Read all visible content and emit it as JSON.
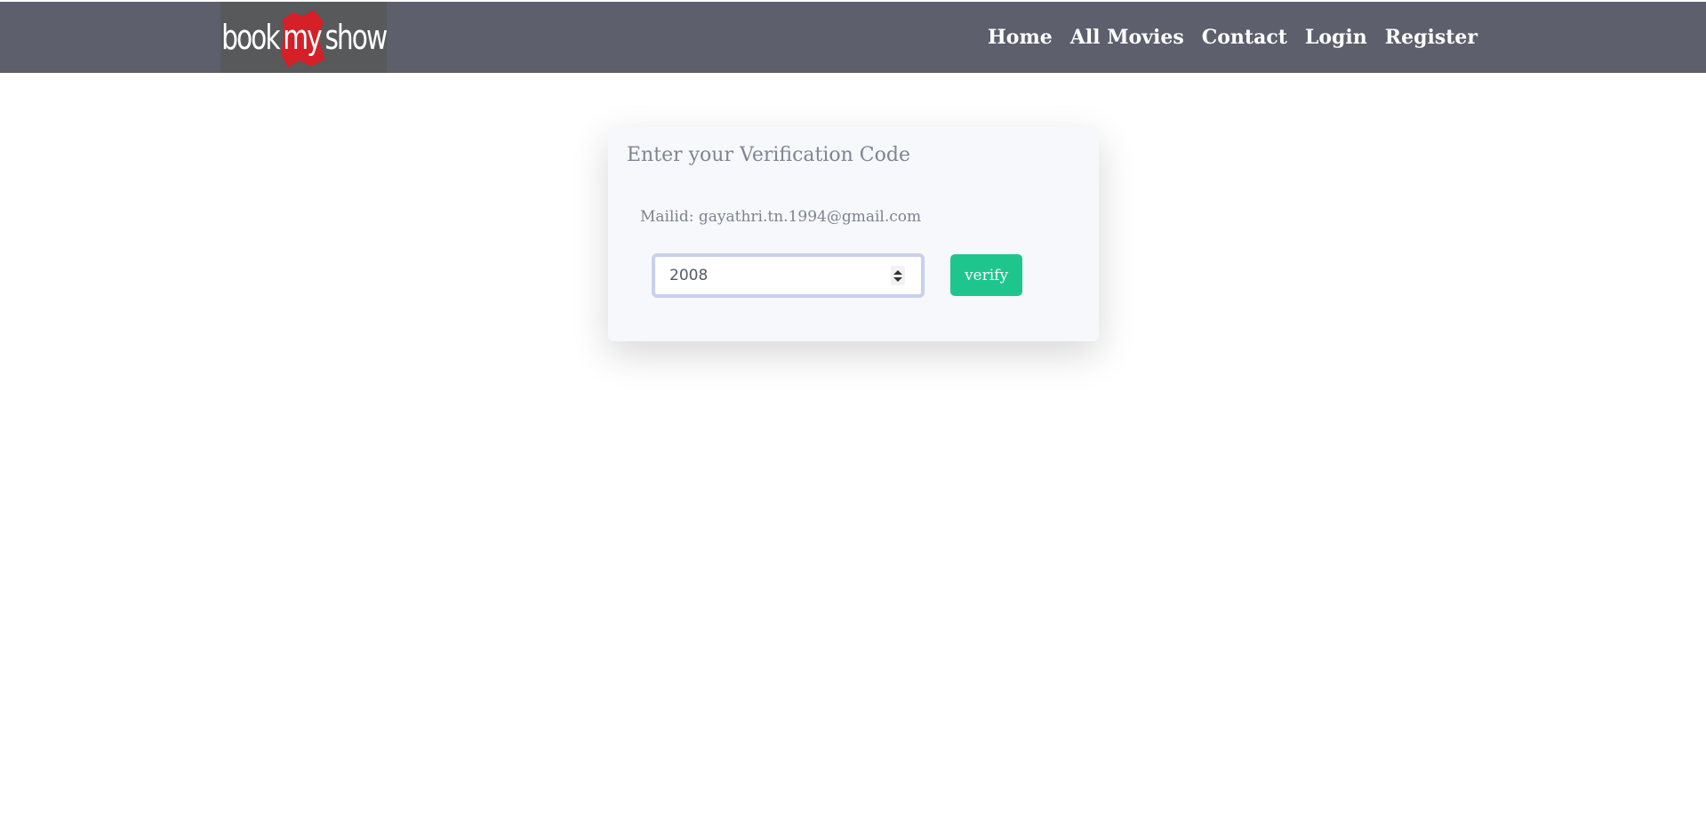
{
  "brand": {
    "logo_left": "book",
    "logo_mid": "my",
    "logo_right": "show",
    "accent": "#d52027"
  },
  "nav": {
    "background": "#5d5f6c",
    "items": [
      {
        "label": "Home"
      },
      {
        "label": "All Movies"
      },
      {
        "label": "Contact"
      },
      {
        "label": "Login"
      },
      {
        "label": "Register"
      }
    ]
  },
  "verification": {
    "title": "Enter your Verification Code",
    "mail_prefix": "Mailid:",
    "email": "gayathri.tn.1994@gmail.com",
    "code_value": "2008",
    "verify_label": "verify",
    "button_color": "#1ec68d"
  },
  "icons": {
    "spinner": "number-spinner-icon"
  }
}
